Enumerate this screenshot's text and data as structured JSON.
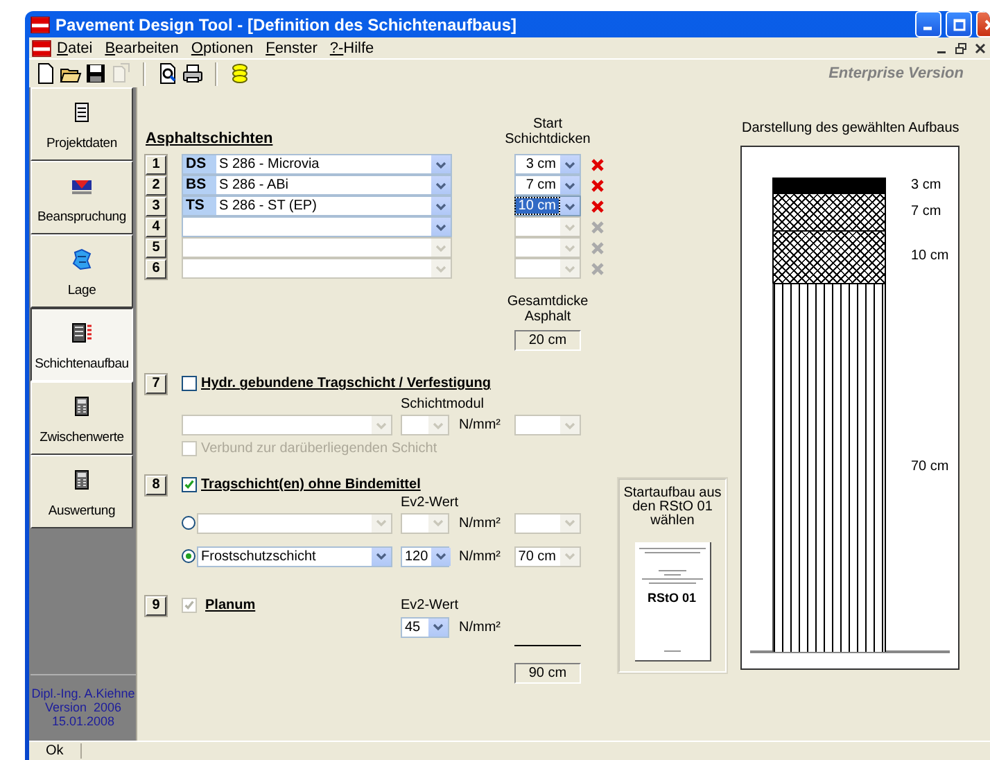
{
  "window": {
    "title": "Pavement Design Tool - [Definition des Schichtenaufbaus]"
  },
  "menu": [
    {
      "label": "Datei"
    },
    {
      "label": "Bearbeiten"
    },
    {
      "label": "Optionen"
    },
    {
      "label": "Fenster"
    },
    {
      "label": "?-Hilfe"
    }
  ],
  "toolbar": {
    "groups": [
      [
        {
          "kind": "new",
          "disabled": false
        },
        {
          "kind": "open",
          "disabled": false
        },
        {
          "kind": "save",
          "disabled": false
        },
        {
          "kind": "export",
          "disabled": true
        }
      ],
      [
        {
          "kind": "preview",
          "disabled": false
        },
        {
          "kind": "print",
          "disabled": false
        }
      ],
      [
        {
          "kind": "coins",
          "disabled": false
        }
      ]
    ],
    "edition": "Enterprise Version"
  },
  "sidebar": {
    "items": [
      {
        "label": "Projektdaten",
        "kind": "document",
        "selected": false
      },
      {
        "label": "Beanspruchung",
        "kind": "load",
        "selected": false
      },
      {
        "label": "Lage",
        "kind": "map",
        "selected": false
      },
      {
        "label": "Schichtenaufbau",
        "kind": "layers",
        "selected": true
      },
      {
        "label": "Zwischenwerte",
        "kind": "calculator",
        "selected": false
      },
      {
        "label": "Auswertung",
        "kind": "calculator",
        "selected": false
      }
    ],
    "credits": [
      "Dipl.-Ing. A.Kiehne",
      "Version  2006",
      "15.01.2008"
    ]
  },
  "asphalt": {
    "heading": "Asphaltschichten",
    "thickness_header": "Start Schichtdicken",
    "rows": [
      {
        "number": "1",
        "code": "DS",
        "material": "S 286 - Microvia",
        "thickness": "3 cm",
        "disabled": false,
        "thickness_disabled": false,
        "focused": false
      },
      {
        "number": "2",
        "code": "BS",
        "material": "S 286 - ABi",
        "thickness": "7 cm",
        "disabled": false,
        "thickness_disabled": false,
        "focused": false
      },
      {
        "number": "3",
        "code": "TS",
        "material": "S 286 - ST (EP)",
        "thickness": "10 cm",
        "disabled": false,
        "thickness_disabled": false,
        "focused": true
      },
      {
        "number": "4",
        "disabled": false,
        "thickness_disabled": true,
        "focused": false
      },
      {
        "number": "5",
        "disabled": true,
        "thickness_disabled": true,
        "focused": false
      },
      {
        "number": "6",
        "disabled": true,
        "thickness_disabled": true,
        "focused": false
      }
    ],
    "total_label": "Gesamtdicke Asphalt",
    "total": "20 cm"
  },
  "bound_base": {
    "number": "7",
    "title": "Hydr. gebundene Tragschicht / Verfestigung",
    "checked": false,
    "modulus_label": "Schichtmodul",
    "unit": "N/mm²",
    "bond": {
      "label": "Verbund zur darüberliegenden Schicht",
      "checked": false,
      "disabled": true
    }
  },
  "unbound_base": {
    "number": "8",
    "title": "Tragschicht(en) ohne Bindemittel",
    "checked": true,
    "modulus_label": "Ev2-Wert",
    "options": [
      {
        "selected": false,
        "disabled": true,
        "unit": "N/mm²"
      },
      {
        "selected": true,
        "disabled": false,
        "material": "Frostschutzschicht",
        "modulus": "120",
        "unit": "N/mm²",
        "thickness": "70 cm"
      }
    ]
  },
  "subgrade": {
    "number": "9",
    "title": "Planum",
    "checked": true,
    "disabled": true,
    "modulus_label": "Ev2-Wert",
    "modulus": "45",
    "unit": "N/mm²"
  },
  "grand_total": "90 cm",
  "rsto": {
    "caption": "Startaufbau aus den RStO 01 wählen",
    "document_title": "RStO 01"
  },
  "diagram": {
    "title": "Darstellung des gewählten Aufbaus",
    "layers": [
      {
        "kind": "solid",
        "label": "3 cm"
      },
      {
        "kind": "crosshatch",
        "label": "7 cm"
      },
      {
        "kind": "crosshatch",
        "label": "10 cm"
      },
      {
        "kind": "vertical",
        "label": "70 cm"
      }
    ]
  },
  "status_bar": {
    "text": "Ok"
  }
}
